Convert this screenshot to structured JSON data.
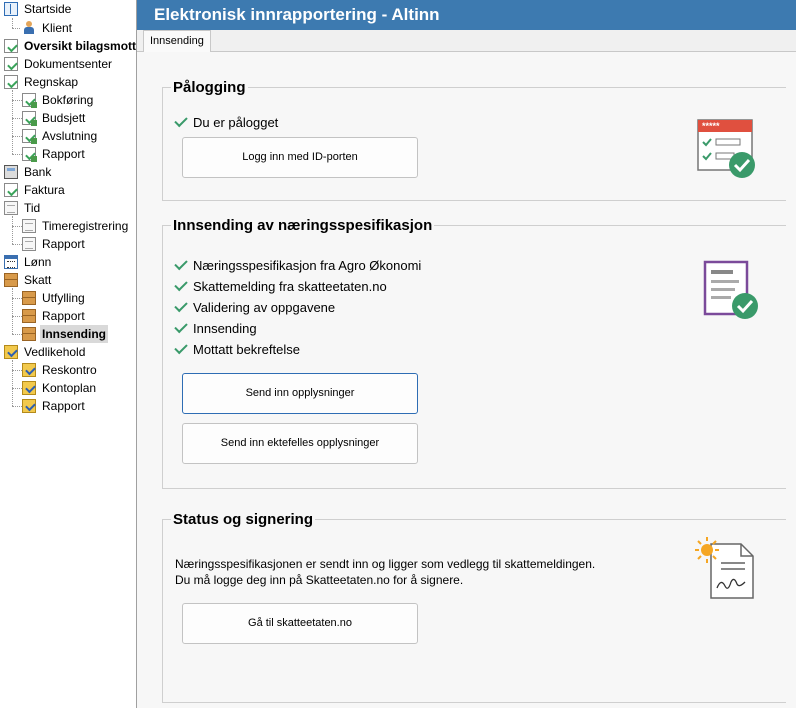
{
  "sidebar": {
    "items": [
      {
        "label": "Startside"
      },
      {
        "label": "Klient"
      },
      {
        "label": "Oversikt bilagsmottak"
      },
      {
        "label": "Dokumentsenter"
      },
      {
        "label": "Regnskap"
      },
      {
        "label": "Bokføring"
      },
      {
        "label": "Budsjett"
      },
      {
        "label": "Avslutning"
      },
      {
        "label": "Rapport"
      },
      {
        "label": "Bank"
      },
      {
        "label": "Faktura"
      },
      {
        "label": "Tid"
      },
      {
        "label": "Timeregistrering"
      },
      {
        "label": "Rapport"
      },
      {
        "label": "Lønn"
      },
      {
        "label": "Skatt"
      },
      {
        "label": "Utfylling"
      },
      {
        "label": "Rapport"
      },
      {
        "label": "Innsending"
      },
      {
        "label": "Vedlikehold"
      },
      {
        "label": "Reskontro"
      },
      {
        "label": "Kontoplan"
      },
      {
        "label": "Rapport"
      }
    ],
    "selected": "Innsending"
  },
  "header": {
    "title": "Elektronisk innrapportering - Altinn"
  },
  "tabs": [
    {
      "label": "Innsending"
    }
  ],
  "logon": {
    "title": "Pålogging",
    "status": "Du er pålogget",
    "button": "Logg inn med ID-porten",
    "password_mask": "*****"
  },
  "submission": {
    "title": "Innsending av næringsspesifikasjon",
    "steps": [
      "Næringsspesifikasjon fra Agro Økonomi",
      "Skattemelding fra skatteetaten.no",
      "Validering av oppgavene",
      "Innsending",
      "Mottatt bekreftelse"
    ],
    "send_button": "Send inn opplysninger",
    "send_spouse_button": "Send inn ektefelles opplysninger"
  },
  "status": {
    "title": "Status og signering",
    "line1": "Næringsspesifikasjonen er sendt inn og ligger som vedlegg til skattemeldingen.",
    "line2": "Du må logge deg inn på Skatteetaten.no for å signere.",
    "button": "Gå til skatteetaten.no"
  },
  "colors": {
    "titlebar": "#3d7ab0",
    "check": "#3a9a6a",
    "primary_border": "#2e6db4"
  }
}
